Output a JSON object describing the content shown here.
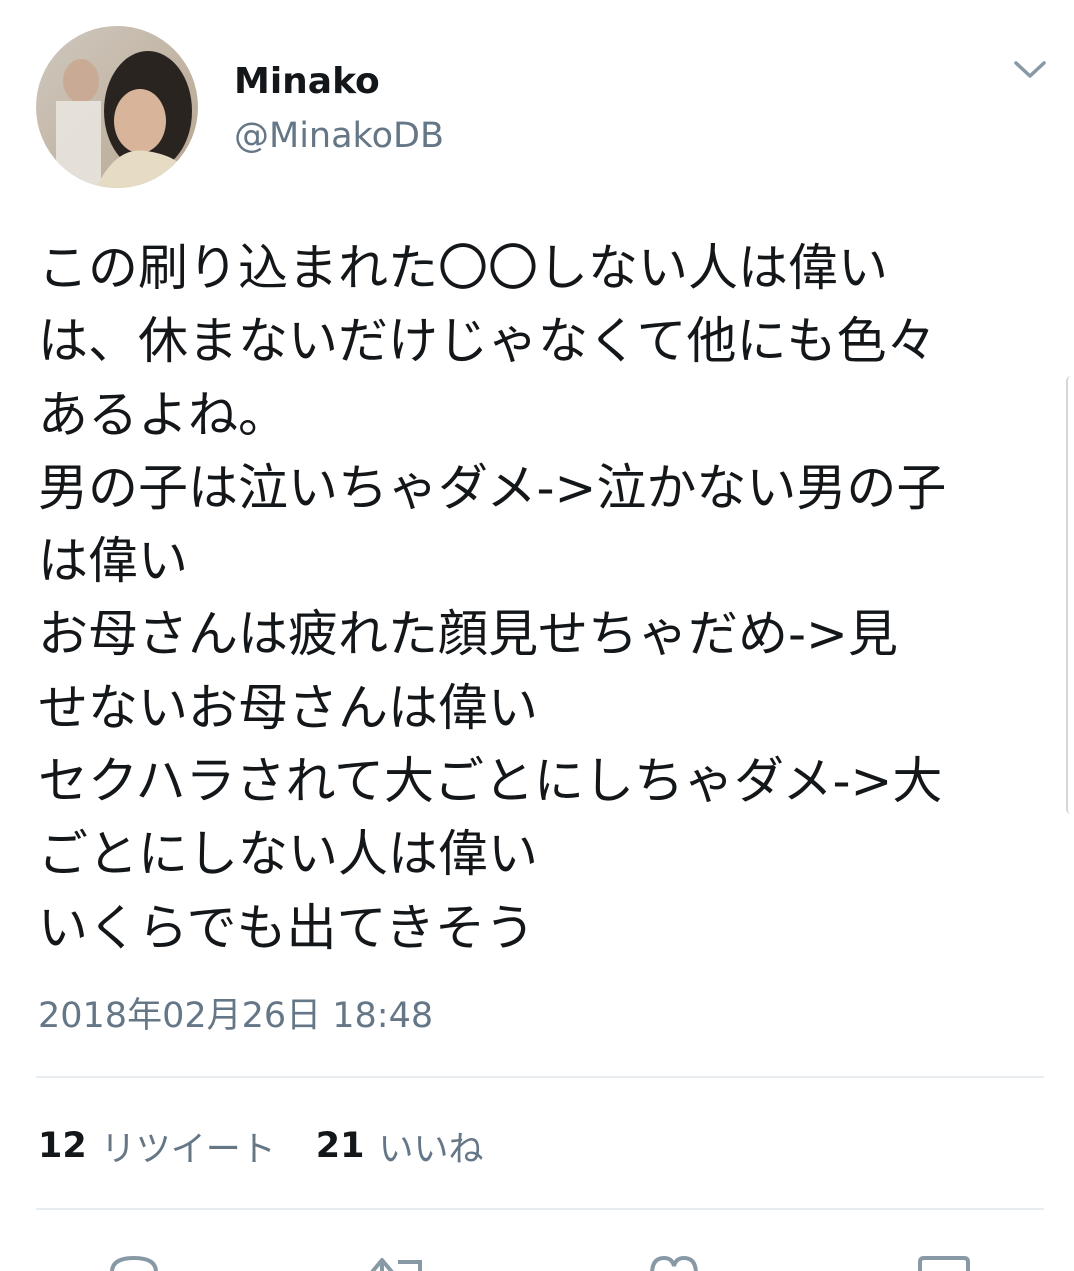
{
  "tweet": {
    "author": {
      "display_name": "Minako",
      "handle": "@MinakoDB"
    },
    "menu_icon": "chevron-down-icon",
    "text_lines": [
      "この刷り込まれた〇〇しない人は偉い",
      "は、休まないだけじゃなくて他にも色々",
      "あるよね。",
      "男の子は泣いちゃダメ->泣かない男の子",
      "は偉い",
      "お母さんは疲れた顔見せちゃだめ->見",
      "せないお母さんは偉い",
      "セクハラされて大ごとにしちゃダメ->大",
      "ごとにしない人は偉い",
      "いくらでも出てきそう"
    ],
    "timestamp": "2018年02月26日 18:48",
    "stats": {
      "retweets": {
        "count": "12",
        "label": "リツイート"
      },
      "likes": {
        "count": "21",
        "label": "いいね"
      }
    },
    "actions": [
      "reply-icon",
      "retweet-icon",
      "like-icon",
      "share-icon"
    ]
  },
  "colors": {
    "text_primary": "#14171a",
    "text_secondary": "#657786",
    "divider": "#e6ecf0",
    "icon": "#8899a6"
  }
}
